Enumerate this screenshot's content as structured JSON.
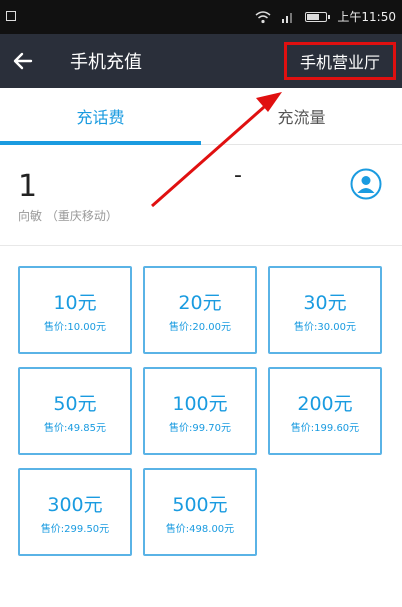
{
  "status_bar": {
    "time": "上午11:50"
  },
  "app_bar": {
    "title": "手机充值",
    "hall_button": "手机营业厅"
  },
  "tabs": [
    {
      "label": "充话费",
      "active": true
    },
    {
      "label": "充流量",
      "active": false
    }
  ],
  "phone": {
    "number": "1",
    "owner": "向敏 （重庆移动）"
  },
  "cards": [
    {
      "amount": "10元",
      "price": "售价:10.00元"
    },
    {
      "amount": "20元",
      "price": "售价:20.00元"
    },
    {
      "amount": "30元",
      "price": "售价:30.00元"
    },
    {
      "amount": "50元",
      "price": "售价:49.85元"
    },
    {
      "amount": "100元",
      "price": "售价:99.70元"
    },
    {
      "amount": "200元",
      "price": "售价:199.60元"
    },
    {
      "amount": "300元",
      "price": "售价:299.50元"
    },
    {
      "amount": "500元",
      "price": "售价:498.00元"
    }
  ],
  "colors": {
    "accent": "#1a9be0",
    "appbar": "#2a2f3a",
    "annotation": "#e01010"
  },
  "icons": [
    "back-arrow-icon",
    "contact-icon",
    "wifi-icon",
    "signal-icon",
    "battery-icon"
  ]
}
